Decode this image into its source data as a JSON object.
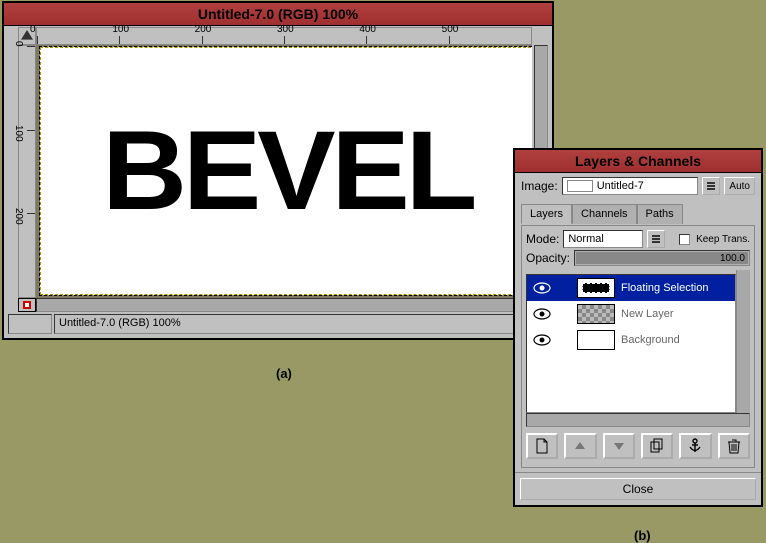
{
  "image_window": {
    "title": "Untitled-7.0 (RGB) 100%",
    "canvas_text": "BEVEL",
    "status_text": "Untitled-7.0 (RGB) 100%",
    "ruler_h": [
      "0",
      "100",
      "200",
      "300",
      "400",
      "500"
    ],
    "ruler_v": [
      "0",
      "100",
      "200"
    ]
  },
  "captions": {
    "a": "(a)",
    "b": "(b)"
  },
  "layers_dialog": {
    "title": "Layers & Channels",
    "image_label": "Image:",
    "image_name": "Untitled-7",
    "auto_label": "Auto",
    "tabs": [
      "Layers",
      "Channels",
      "Paths"
    ],
    "mode_label": "Mode:",
    "mode_value": "Normal",
    "keep_trans_label": "Keep Trans.",
    "opacity_label": "Opacity:",
    "opacity_value": "100.0",
    "layers": [
      {
        "name": "Floating Selection",
        "selected": true,
        "thumb": "floating"
      },
      {
        "name": "New Layer",
        "selected": false,
        "thumb": "checker"
      },
      {
        "name": "Background",
        "selected": false,
        "thumb": "white"
      }
    ],
    "close_label": "Close"
  }
}
